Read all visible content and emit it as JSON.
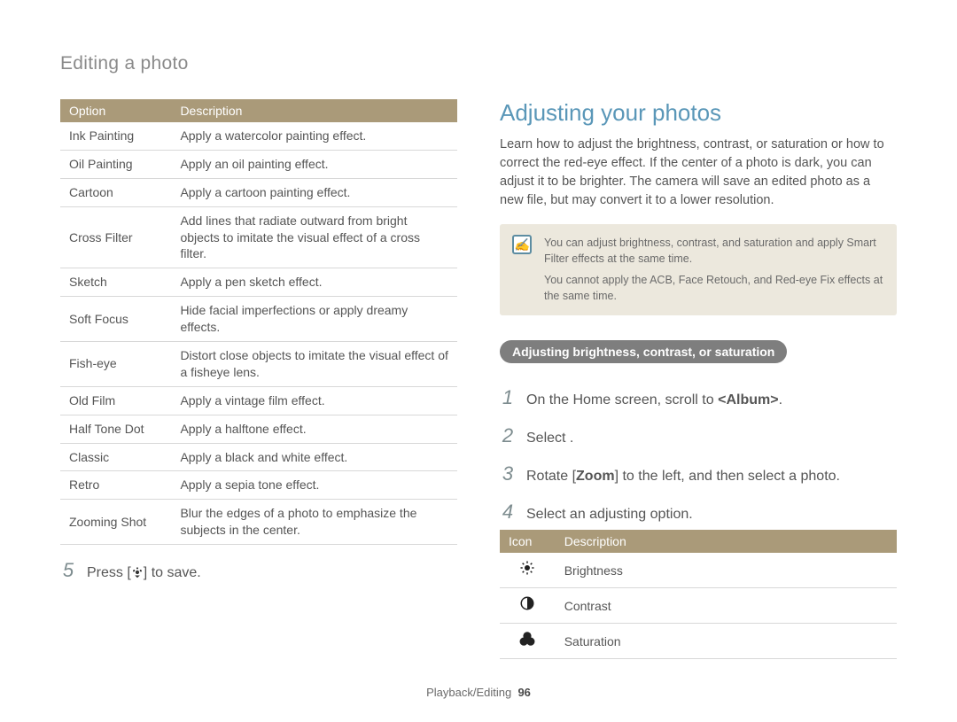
{
  "header": "Editing a photo",
  "leftTable": {
    "cols": [
      "Option",
      "Description"
    ],
    "rows": [
      {
        "opt": "Ink Painting",
        "desc": "Apply a watercolor painting effect."
      },
      {
        "opt": "Oil Painting",
        "desc": "Apply an oil painting effect."
      },
      {
        "opt": "Cartoon",
        "desc": "Apply a cartoon painting effect."
      },
      {
        "opt": "Cross Filter",
        "desc": "Add lines that radiate outward from bright objects to imitate the visual effect of a cross filter."
      },
      {
        "opt": "Sketch",
        "desc": "Apply a pen sketch effect."
      },
      {
        "opt": "Soft Focus",
        "desc": "Hide facial imperfections or apply dreamy effects."
      },
      {
        "opt": "Fish-eye",
        "desc": "Distort close objects to imitate the visual effect of a fisheye lens."
      },
      {
        "opt": "Old Film",
        "desc": "Apply a vintage film effect."
      },
      {
        "opt": "Half Tone Dot",
        "desc": "Apply a halftone effect."
      },
      {
        "opt": "Classic",
        "desc": "Apply a black and white effect."
      },
      {
        "opt": "Retro",
        "desc": "Apply a sepia tone effect."
      },
      {
        "opt": "Zooming Shot",
        "desc": "Blur the edges of a photo to emphasize the subjects in the center."
      }
    ]
  },
  "leftStep": {
    "num": "5",
    "before": "Press [",
    "after": "] to save."
  },
  "right": {
    "title": "Adjusting your photos",
    "intro": "Learn how to adjust the brightness, contrast, or saturation or how to correct the red-eye effect. If the center of a photo is dark, you can adjust it to be brighter. The camera will save an edited photo as a new file, but may convert it to a lower resolution.",
    "notes": [
      "You can adjust brightness, contrast, and saturation and apply Smart Filter effects at the same time.",
      "You cannot apply the ACB, Face Retouch, and Red-eye Fix effects at the same time."
    ],
    "pill": "Adjusting brightness, contrast, or saturation",
    "steps": [
      {
        "num": "1",
        "html": "On the Home screen, scroll to <b>&lt;Album&gt;</b>."
      },
      {
        "num": "2",
        "html": "Select      ."
      },
      {
        "num": "3",
        "html": "Rotate [<b>Zoom</b>] to the left, and then select a photo."
      },
      {
        "num": "4",
        "html": "Select an adjusting option."
      }
    ],
    "iconTable": {
      "cols": [
        "Icon",
        "Description"
      ],
      "rows": [
        {
          "icon": "brightness-icon",
          "desc": "Brightness"
        },
        {
          "icon": "contrast-icon",
          "desc": "Contrast"
        },
        {
          "icon": "saturation-icon",
          "desc": "Saturation"
        }
      ]
    }
  },
  "footer": {
    "section": "Playback/Editing",
    "page": "96"
  }
}
